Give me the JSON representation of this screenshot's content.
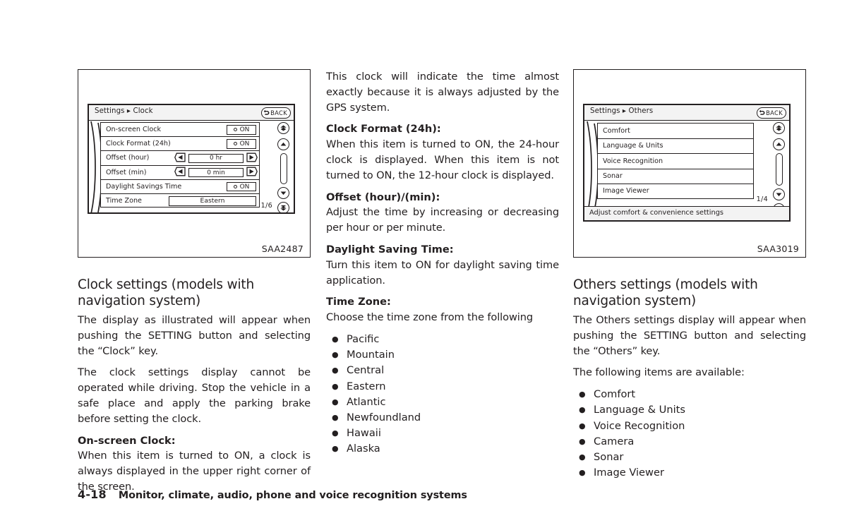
{
  "footer": {
    "page_number": "4-18",
    "chapter_title": "Monitor, climate, audio, phone and voice recognition systems"
  },
  "left_column": {
    "figure": {
      "code": "SAA2487",
      "screen": {
        "breadcrumb": "Settings  ▸ Clock",
        "back_label": "BACK",
        "page_indicator": "1/6",
        "rows": [
          {
            "label": "On-screen Clock",
            "control": "toggle",
            "value": "ON"
          },
          {
            "label": "Clock Format (24h)",
            "control": "toggle",
            "value": "ON"
          },
          {
            "label": "Offset (hour)",
            "control": "stepper",
            "value": "0 hr"
          },
          {
            "label": "Offset (min)",
            "control": "stepper",
            "value": "0 min"
          },
          {
            "label": "Daylight Savings Time",
            "control": "toggle",
            "value": "ON"
          },
          {
            "label": "Time Zone",
            "control": "field",
            "value": "Eastern"
          }
        ]
      }
    },
    "section_title": "Clock settings (models with navigation system)",
    "paragraph_1": "The display as illustrated will appear when pushing the SETTING button and selecting the “Clock” key.",
    "paragraph_2": "The clock settings display cannot be operated while driving. Stop the vehicle in a safe place and apply the parking brake before setting the clock.",
    "subhead_1": "On-screen Clock:",
    "paragraph_3": "When this item is turned to ON, a clock is always displayed in the upper right corner of the screen."
  },
  "middle_column": {
    "paragraph_1": "This clock will indicate the time almost exactly because it is always adjusted by the GPS system.",
    "subhead_1": "Clock Format (24h):",
    "paragraph_2": "When this item is turned to ON, the 24-hour clock is displayed. When this item is not turned to ON, the 12-hour clock is displayed.",
    "subhead_2": "Offset (hour)/(min):",
    "paragraph_3": "Adjust the time by increasing or decreasing per hour or per minute.",
    "subhead_3": "Daylight Saving Time:",
    "paragraph_4": "Turn this item to ON for daylight saving time application.",
    "subhead_4": "Time Zone:",
    "paragraph_5": "Choose the time zone from the following",
    "time_zones": [
      "Pacific",
      "Mountain",
      "Central",
      "Eastern",
      "Atlantic",
      "Newfoundland",
      "Hawaii",
      "Alaska"
    ]
  },
  "right_column": {
    "figure": {
      "code": "SAA3019",
      "screen": {
        "breadcrumb": "Settings  ▸ Others",
        "back_label": "BACK",
        "page_indicator": "1/4",
        "status_text": "Adjust comfort & convenience settings",
        "rows": [
          {
            "label": "Comfort"
          },
          {
            "label": "Language & Units"
          },
          {
            "label": "Voice Recognition"
          },
          {
            "label": "Sonar"
          },
          {
            "label": "Image Viewer"
          }
        ]
      }
    },
    "section_title": "Others settings (models with navigation system)",
    "paragraph_1": "The Others settings display will appear when pushing the SETTING button and selecting the “Others” key.",
    "paragraph_2": "The following items are available:",
    "items": [
      "Comfort",
      "Language & Units",
      "Voice Recognition",
      "Camera",
      "Sonar",
      "Image Viewer"
    ]
  },
  "bullet_glyph": "●",
  "colors": {
    "ink": "#231f20",
    "paper": "#ffffff",
    "screen_bar": "#f3f3f3"
  }
}
